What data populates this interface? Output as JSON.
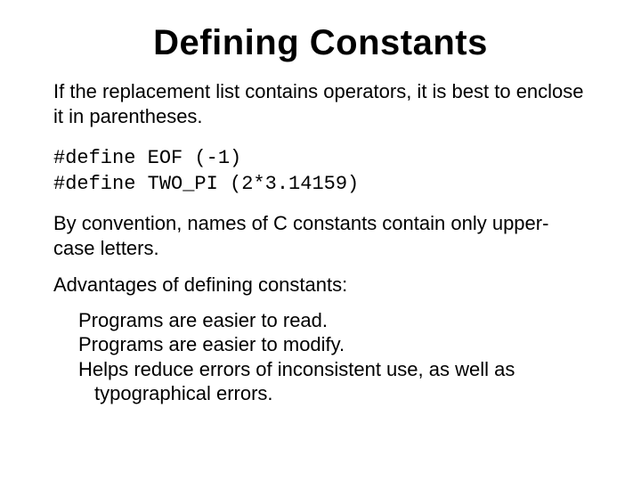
{
  "title": "Defining Constants",
  "intro": "If the replacement list contains operators, it is best to enclose it in parentheses.",
  "code_line1": "#define EOF (-1)",
  "code_line2": "#define TWO_PI (2*3.14159)",
  "convention": "By convention, names of C constants contain only upper-case letters.",
  "advantages_heading": "Advantages of defining constants:",
  "adv1": "Programs are easier to read.",
  "adv2": "Programs are easier to modify.",
  "adv3": "Helps reduce errors of inconsistent use, as well as typographical errors."
}
